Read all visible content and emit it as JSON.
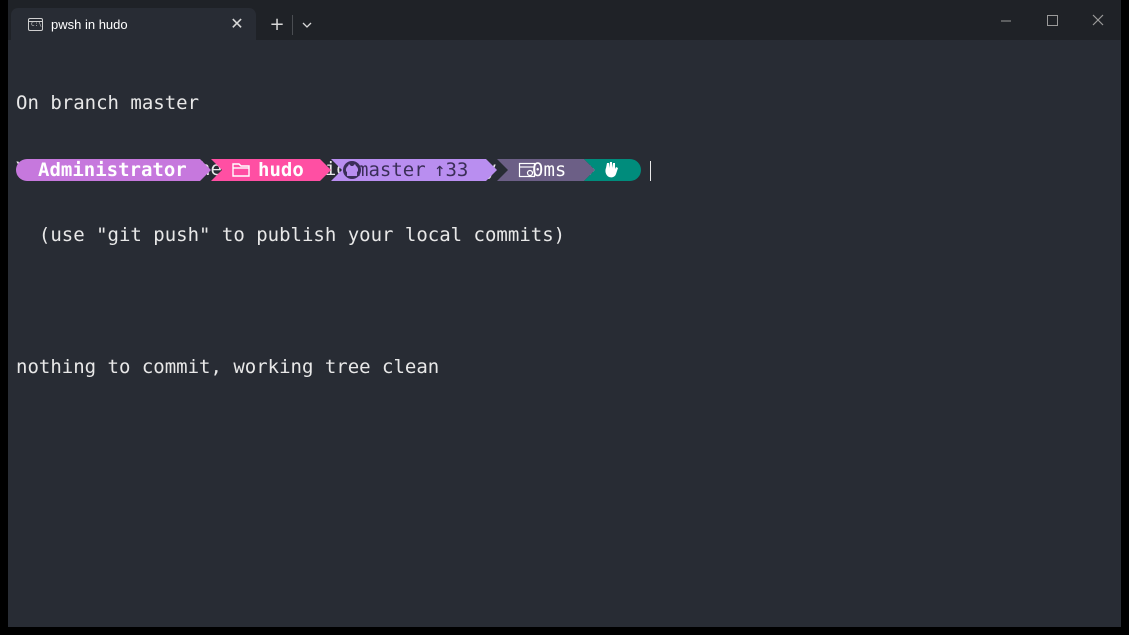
{
  "window": {
    "tab_title": "pwsh in hudo",
    "tab_icon_glyph": "C:\\",
    "new_tab_glyph": "+",
    "close_glyph": "✕"
  },
  "terminal": {
    "lines": [
      "On branch master",
      "Your branch is ahead of 'origin/master' by 33 commits.",
      "  (use \"git push\" to publish your local commits)",
      "",
      "nothing to commit, working tree clean"
    ]
  },
  "prompt": {
    "user": "Administrator",
    "folder": "hudo",
    "branch": "master",
    "ahead": "↑33",
    "duration": "0ms",
    "colors": {
      "user_bg": "#c678dd",
      "folder_bg": "#ff4fa3",
      "git_bg": "#b98ef0",
      "time_bg": "#6c5f86",
      "status_bg": "#008c7c",
      "dark_text": "#3b2e58",
      "light_text": "#ffffff"
    },
    "icons": [
      "folder-icon",
      "github-icon",
      "timer-icon",
      "hand-icon"
    ]
  }
}
